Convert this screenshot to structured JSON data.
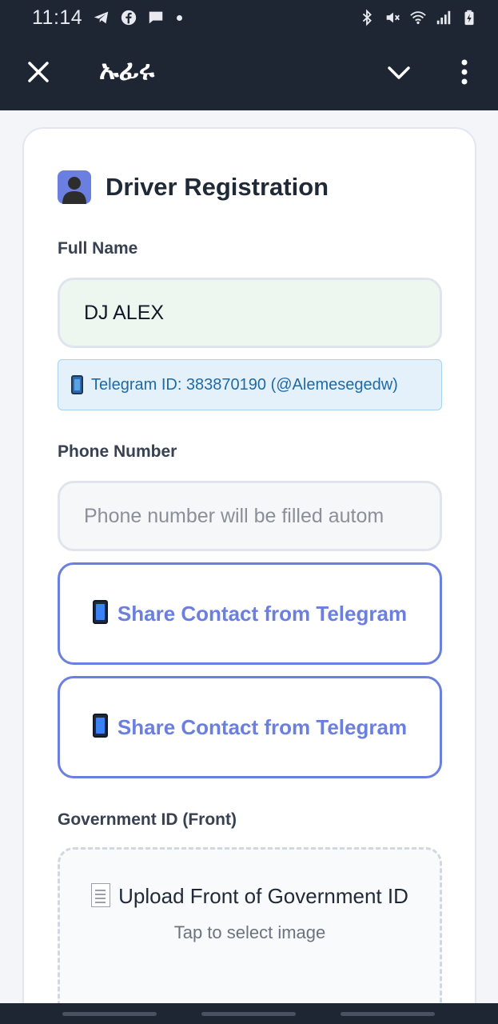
{
  "status_bar": {
    "time": "11:14",
    "left_icons": [
      "telegram-icon",
      "facebook-icon",
      "message-icon",
      "dot-icon"
    ],
    "right_icons": [
      "bluetooth-icon",
      "mute-icon",
      "wifi-icon",
      "signal-icon",
      "battery-icon"
    ]
  },
  "title_bar": {
    "title": "ኡፊሩ",
    "close_icon": "close-icon",
    "chevron_icon": "chevron-down-icon",
    "more_icon": "more-vert-icon"
  },
  "form": {
    "title": "Driver Registration",
    "full_name": {
      "label": "Full Name",
      "value": "DJ ALEX"
    },
    "telegram_info": "Telegram ID: 383870190 (@Alemesegedw)",
    "phone": {
      "label": "Phone Number",
      "placeholder": "Phone number will be filled autom"
    },
    "share_buttons": [
      {
        "label": "Share Contact from Telegram"
      },
      {
        "label": "Share Contact from Telegram"
      }
    ],
    "gov_id_front": {
      "label": "Government ID (Front)",
      "upload_title": "Upload Front of Government ID",
      "upload_hint": "Tap to select image"
    }
  },
  "colors": {
    "app_bar": "#1e2533",
    "accent": "#6b7fe0",
    "info_bg": "#e4f1fb",
    "info_text": "#1f6aa6",
    "filled_input_bg": "#eef6f0"
  }
}
